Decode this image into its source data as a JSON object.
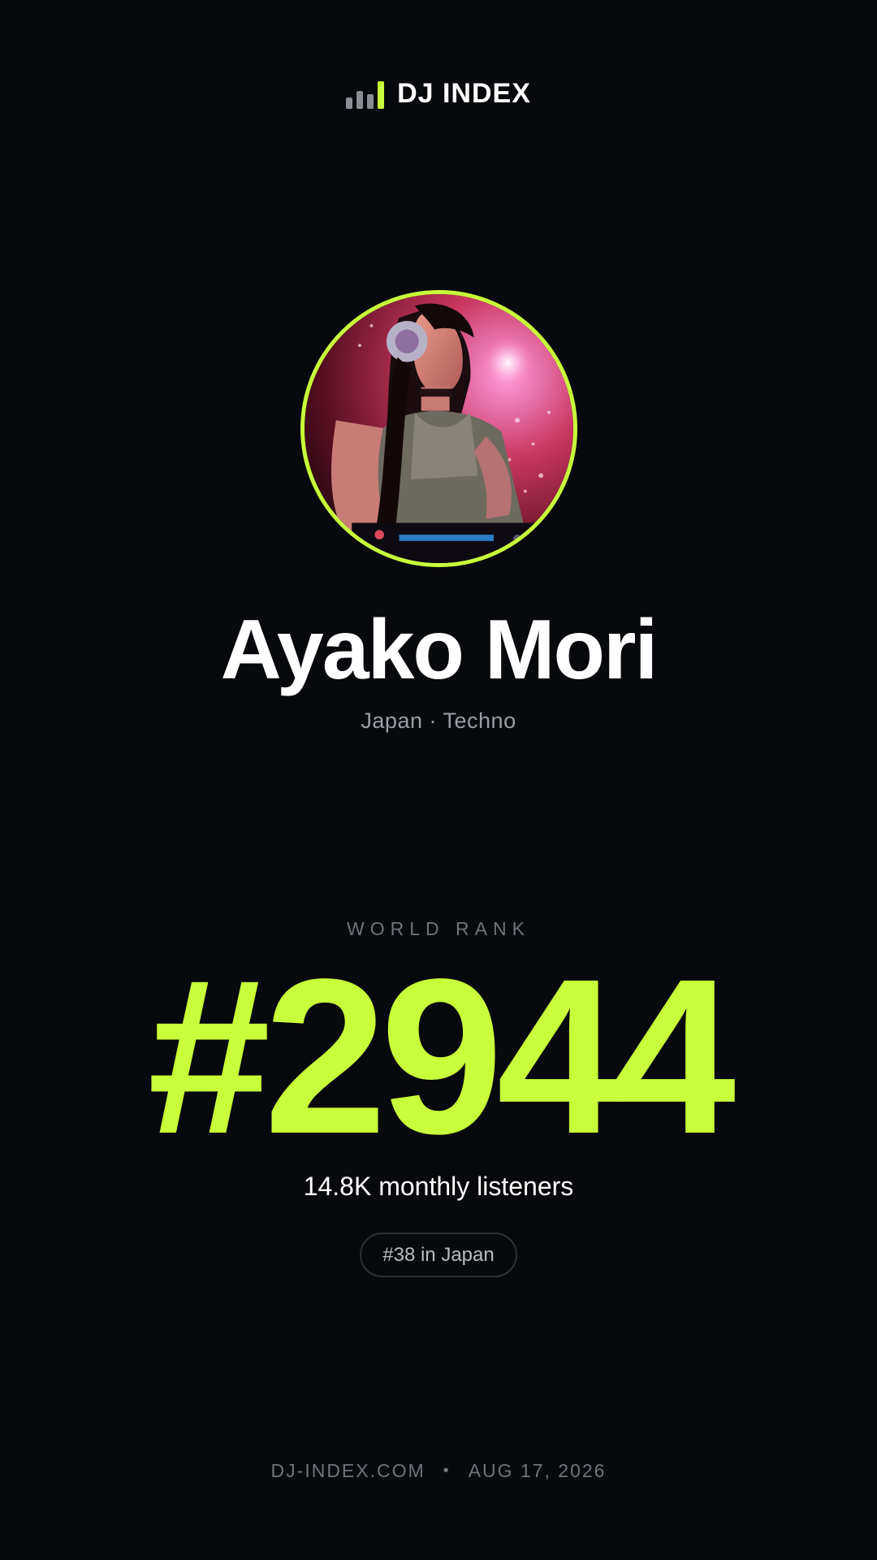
{
  "brand": {
    "name": "DJ INDEX",
    "bars_icon": "bar-chart-icon",
    "accent_color": "#c8ff3a"
  },
  "profile": {
    "name": "Ayako Mori",
    "country": "Japan",
    "separator": "·",
    "genre": "Techno",
    "avatar_icon": "dj-photo"
  },
  "rank": {
    "label": "WORLD RANK",
    "value": "#2944",
    "listeners": "14.8K monthly listeners",
    "country_rank": "#38 in Japan"
  },
  "footer": {
    "site": "DJ-INDEX.COM",
    "separator": "•",
    "date": "AUG 17, 2026"
  }
}
